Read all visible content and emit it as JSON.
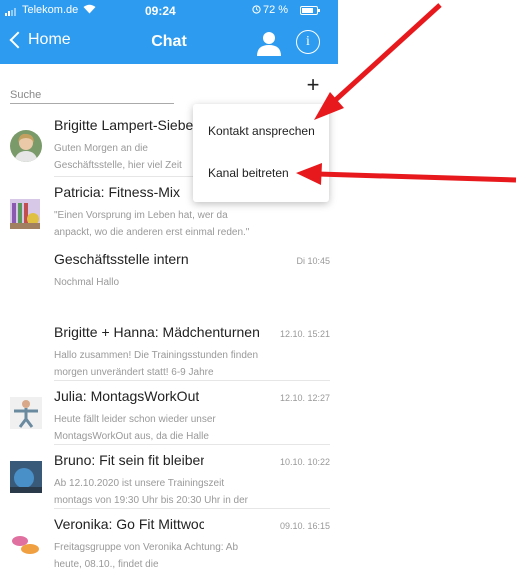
{
  "status_bar": {
    "carrier": "Telekom.de",
    "time": "09:24",
    "battery": "72 %"
  },
  "nav": {
    "back_label": "Home",
    "title": "Chat"
  },
  "search": {
    "placeholder": "Suche",
    "add_label": "+"
  },
  "menu": {
    "items": [
      "Kontakt ansprechen",
      "Kanal beitreten"
    ]
  },
  "chats": [
    {
      "name": "Brigitte Lampert-Sieber",
      "time": "",
      "preview": "Guten Morgen an die Geschäftsstelle, hier viel Zeit gehabt mich auf d",
      "avatar": "woman-portrait"
    },
    {
      "name": "Patricia: Fitness-Mix",
      "time": "",
      "preview": "\"Einen Vorsprung im Leben hat, wer da anpackt, wo die anderen erst einmal reden.\"",
      "avatar": "fitness-room"
    },
    {
      "name": "Geschäftsstelle intern",
      "time": "Di 10:45",
      "preview": "Nochmal Hallo",
      "avatar": ""
    },
    {
      "name": "Brigitte + Hanna: Mädchenturnen",
      "time": "12.10. 15:21",
      "preview": "Hallo zusammen! Die Trainingsstunden finden morgen unverändert statt! 6-9 Jahre",
      "avatar": ""
    },
    {
      "name": "Julia: MontagsWorkOut",
      "time": "12.10. 12:27",
      "preview": "Heute fällt leider schon wieder unser MontagsWorkOut aus, da die Halle",
      "avatar": "yoga-pose"
    },
    {
      "name": "Bruno: Fit sein fit bleiben für",
      "time": "10.10. 10:22",
      "preview": "Ab 12.10.2020 ist unsere Trainingszeit montags von 19:30 Uhr bis 20:30 Uhr in der",
      "avatar": "gym-ball"
    },
    {
      "name": "Veronika: Go Fit Mittwochs- u.",
      "time": "09.10. 16:15",
      "preview": "Freitagsgruppe von Veronika Achtung: Ab heute, 08.10., findet die",
      "avatar": "dumbbells"
    }
  ],
  "colors": {
    "header": "#2d9bf0",
    "arrow": "#e8191c"
  }
}
